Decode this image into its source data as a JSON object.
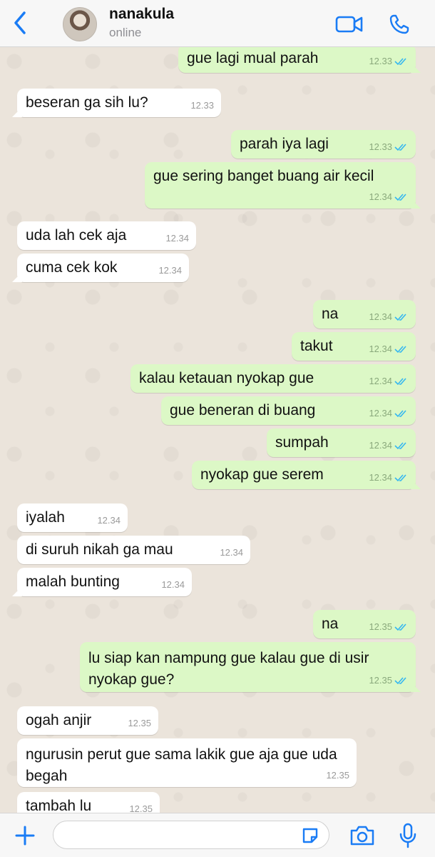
{
  "header": {
    "name": "nanakula",
    "status": "online"
  },
  "messages": [
    {
      "dir": "out",
      "text": "gue lagi mual parah",
      "time": "12.33",
      "read": true
    },
    {
      "dir": "in",
      "text": "beseran ga sih lu?",
      "time": "12.33"
    },
    {
      "dir": "out",
      "text": "parah iya lagi",
      "time": "12.33",
      "read": true
    },
    {
      "dir": "out",
      "text": "gue sering banget buang air kecil",
      "time": "12.34",
      "read": true
    },
    {
      "dir": "in",
      "text": "uda lah cek aja",
      "time": "12.34"
    },
    {
      "dir": "in",
      "text": "cuma cek kok",
      "time": "12.34"
    },
    {
      "dir": "out",
      "text": "na",
      "time": "12.34",
      "read": true
    },
    {
      "dir": "out",
      "text": "takut",
      "time": "12.34",
      "read": true
    },
    {
      "dir": "out",
      "text": "kalau ketauan nyokap gue",
      "time": "12.34",
      "read": true
    },
    {
      "dir": "out",
      "text": "gue beneran di buang",
      "time": "12.34",
      "read": true
    },
    {
      "dir": "out",
      "text": "sumpah",
      "time": "12.34",
      "read": true
    },
    {
      "dir": "out",
      "text": "nyokap gue serem",
      "time": "12.34",
      "read": true
    },
    {
      "dir": "in",
      "text": "iyalah",
      "time": "12.34"
    },
    {
      "dir": "in",
      "text": "di suruh nikah ga mau",
      "time": "12.34"
    },
    {
      "dir": "in",
      "text": "malah bunting",
      "time": "12.34"
    },
    {
      "dir": "out",
      "text": "na",
      "time": "12.35",
      "read": true
    },
    {
      "dir": "out",
      "text": "lu siap kan nampung gue kalau gue di usir nyokap gue?",
      "time": "12.35",
      "read": true
    },
    {
      "dir": "in",
      "text": "ogah anjir",
      "time": "12.35"
    },
    {
      "dir": "in",
      "text": "ngurusin perut gue sama lakik gue aja gue uda begah",
      "time": "12.35"
    },
    {
      "dir": "in",
      "text": "tambah lu",
      "time": "12.35"
    }
  ],
  "input": {
    "value": "",
    "placeholder": ""
  },
  "icons": {
    "back": "chevron-left-icon",
    "video": "video-camera-icon",
    "call": "phone-icon",
    "plus": "plus-icon",
    "sticker": "sticker-icon",
    "camera": "camera-icon",
    "mic": "microphone-icon"
  },
  "colors": {
    "accent": "#1a7cf5",
    "outgoing": "#dcf8c6",
    "incoming": "#ffffff",
    "read_ticks": "#34b7f1"
  }
}
